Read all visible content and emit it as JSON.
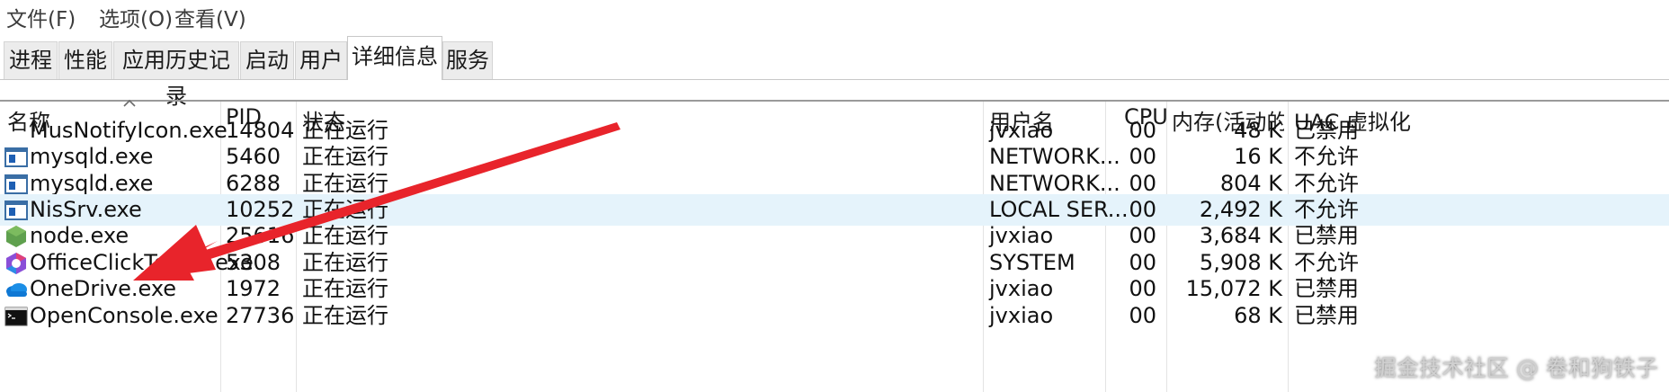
{
  "menu": [
    "文件(F)",
    "选项(O)",
    "查看(V)"
  ],
  "tabs": [
    "进程",
    "性能",
    "应用历史记录",
    "启动",
    "用户",
    "详细信息",
    "服务"
  ],
  "active_tab": "详细信息",
  "columns": {
    "name": "名称",
    "pid": "PID",
    "status": "状态",
    "user": "用户名",
    "cpu": "CPU",
    "memory": "内存(活动的...",
    "uac": "UAC 虚拟化"
  },
  "rows": [
    {
      "name": "MusNotifyIcon.exe",
      "pid": "14804",
      "status": "正在运行",
      "user": "jvxiao",
      "cpu": "00",
      "memory": "48 K",
      "uac": "已禁用",
      "icon": "blank-icon"
    },
    {
      "name": "mysqld.exe",
      "pid": "5460",
      "status": "正在运行",
      "user": "NETWORK...",
      "cpu": "00",
      "memory": "16 K",
      "uac": "不允许",
      "icon": "window-app-icon"
    },
    {
      "name": "mysqld.exe",
      "pid": "6288",
      "status": "正在运行",
      "user": "NETWORK...",
      "cpu": "00",
      "memory": "804 K",
      "uac": "不允许",
      "icon": "window-app-icon"
    },
    {
      "name": "NisSrv.exe",
      "pid": "10252",
      "status": "正在运行",
      "user": "LOCAL SER...",
      "cpu": "00",
      "memory": "2,492 K",
      "uac": "不允许",
      "icon": "window-app-icon"
    },
    {
      "name": "node.exe",
      "pid": "25616",
      "status": "正在运行",
      "user": "jvxiao",
      "cpu": "00",
      "memory": "3,684 K",
      "uac": "已禁用",
      "icon": "nodejs-hexagon-icon"
    },
    {
      "name": "OfficeClickToRun.exe",
      "pid": "5308",
      "status": "正在运行",
      "user": "SYSTEM",
      "cpu": "00",
      "memory": "5,908 K",
      "uac": "不允许",
      "icon": "office-icon"
    },
    {
      "name": "OneDrive.exe",
      "pid": "1972",
      "status": "正在运行",
      "user": "jvxiao",
      "cpu": "00",
      "memory": "15,072 K",
      "uac": "已禁用",
      "icon": "onedrive-cloud-icon"
    },
    {
      "name": "OpenConsole.exe",
      "pid": "27736",
      "status": "正在运行",
      "user": "jvxiao",
      "cpu": "00",
      "memory": "68 K",
      "uac": "已禁用",
      "icon": "console-icon"
    }
  ],
  "watermark": "掘金技术社区 @ 卷和狗铁子",
  "colors": {
    "highlight_row": "#e5f3fb",
    "arrow": "#e8242b",
    "node_green": "#5fa04e",
    "onedrive_blue": "#0f78d4"
  }
}
